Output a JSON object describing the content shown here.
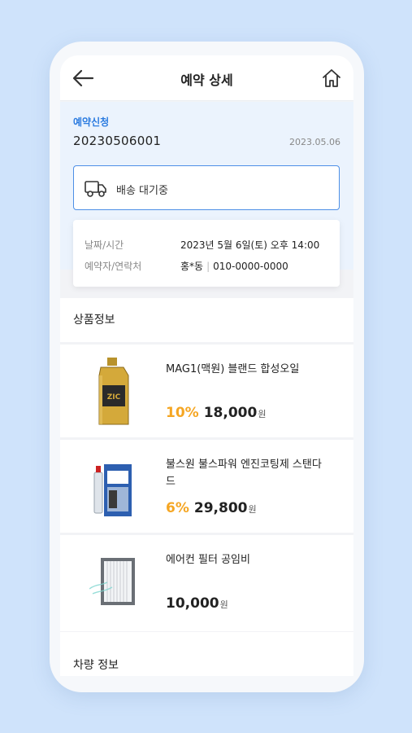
{
  "header": {
    "title": "예약 상세"
  },
  "order": {
    "status_label": "예약신청",
    "number": "20230506001",
    "date": "2023.05.06",
    "delivery_status": "배송 대기중"
  },
  "info": {
    "datetime_label": "날짜/시간",
    "datetime_value": "2023년 5월 6일(토) 오후 14:00",
    "contact_label": "예약자/연락처",
    "contact_name": "홍*동",
    "contact_phone": "010-0000-0000"
  },
  "products_title": "상품정보",
  "products": [
    {
      "name": "MAG1(맥원) 블랜드 합성오일",
      "discount": "10%",
      "price": "18,000",
      "unit": "원"
    },
    {
      "name": "불스원 불스파워 엔진코팅제 스탠다드",
      "discount": "6%",
      "price": "29,800",
      "unit": "원"
    },
    {
      "name": "에어컨 필터 공임비",
      "discount": "",
      "price": "10,000",
      "unit": "원"
    }
  ],
  "vehicle_title": "차량 정보",
  "colors": {
    "accent": "#2b7be0",
    "discount": "#f5a623",
    "background": "#cfe3fb"
  },
  "icons": {
    "back": "arrow-left-icon",
    "home": "home-icon",
    "delivery": "truck-icon"
  }
}
